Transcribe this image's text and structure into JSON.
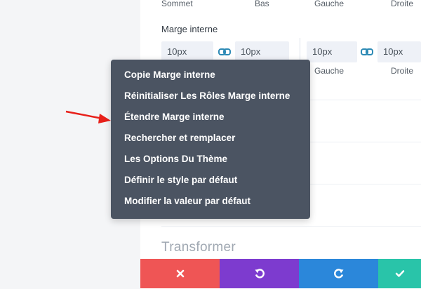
{
  "top_labels": [
    "Sommet",
    "Bas",
    "Gauche",
    "Droite"
  ],
  "section_label": "Marge interne",
  "fields": [
    "10px",
    "10px",
    "10px",
    "10px"
  ],
  "sub_labels": [
    "Gauche",
    "Droite"
  ],
  "context_menu": {
    "items": [
      "Copie Marge interne",
      "Réinitialiser Les Rôles Marge interne",
      "Étendre Marge interne",
      "Rechercher et remplacer",
      "Les Options Du Thème",
      "Définir le style par défaut",
      "Modifier la valeur par défaut"
    ]
  },
  "section_title": "Transformer",
  "colors": {
    "menu_bg": "#4b5462",
    "arrow": "#e8201a",
    "close": "#ef5555",
    "undo": "#7d3bcf",
    "redo": "#2b87da",
    "save": "#29c4a9"
  },
  "icons": {
    "link": "link-icon",
    "close": "close-icon",
    "undo": "undo-icon",
    "redo": "redo-icon",
    "save": "check-icon",
    "pointer": "red-arrow-icon"
  }
}
